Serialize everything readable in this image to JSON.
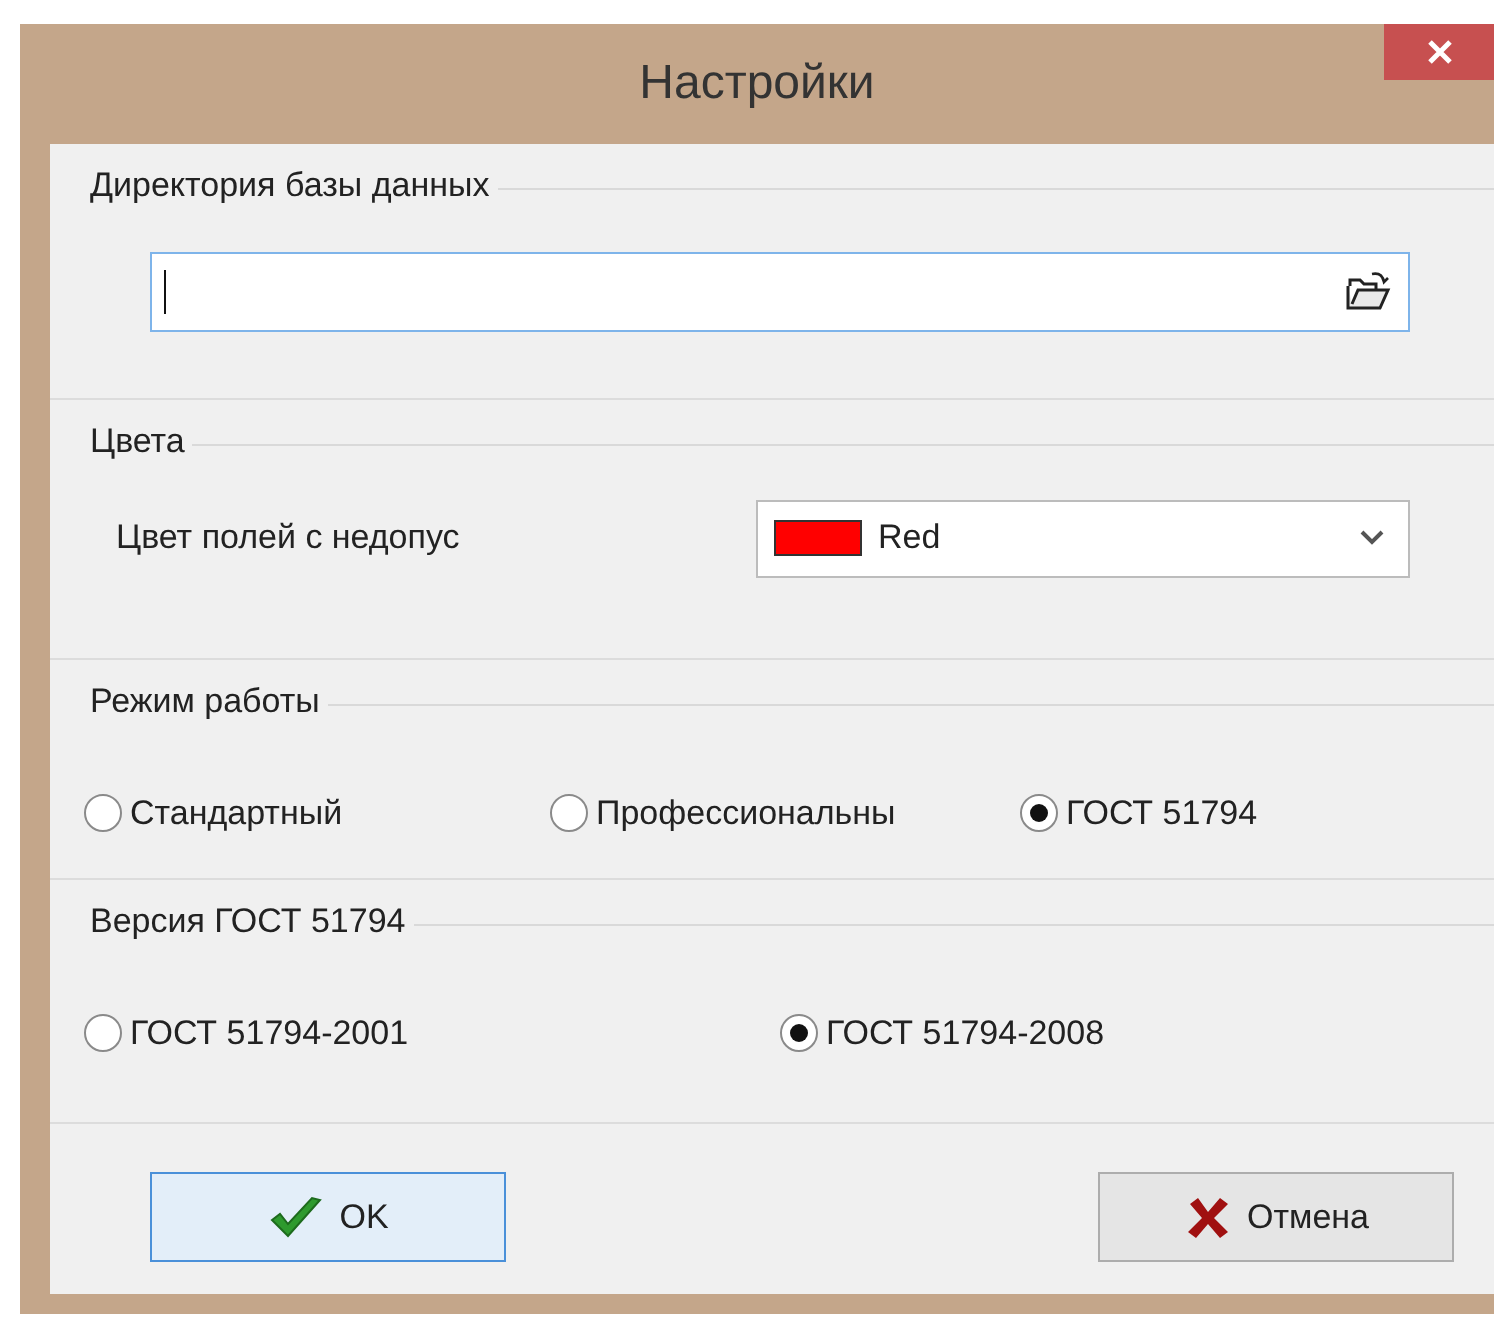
{
  "window": {
    "title": "Настройки"
  },
  "database_directory": {
    "label": "Директория базы данных"
  },
  "colors": {
    "label": "Цвета",
    "field_label": "Цвет полей с недопус",
    "selected_color": {
      "name": "Red",
      "color": "#ff0000"
    }
  },
  "mode": {
    "label": "Режим работы",
    "options": [
      {
        "label": "Стандартный",
        "selected": false
      },
      {
        "label": "Профессиональны",
        "selected": false
      },
      {
        "label": "ГОСТ 51794",
        "selected": true
      }
    ]
  },
  "gost_version": {
    "label": "Версия ГОСТ 51794",
    "options": [
      {
        "label": "ГОСТ 51794-2001",
        "selected": false
      },
      {
        "label": "ГОСТ 51794-2008",
        "selected": true
      }
    ]
  },
  "buttons": [
    {
      "kind": "ok",
      "label": "OK"
    },
    {
      "kind": "cancel",
      "label": "Отмена"
    }
  ]
}
